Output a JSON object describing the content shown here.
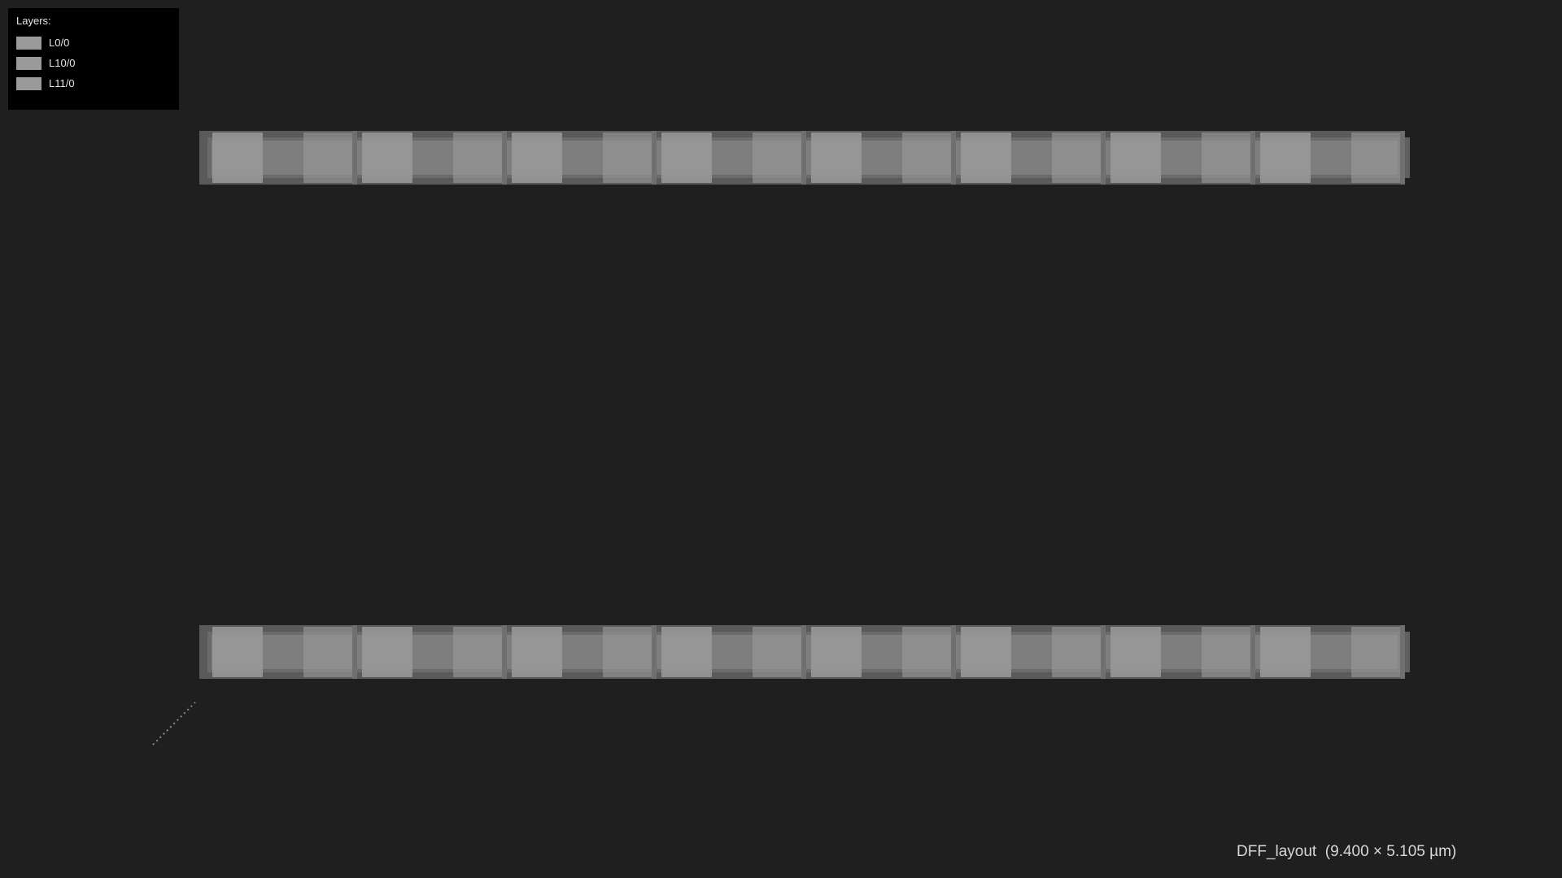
{
  "legend": {
    "title": "Layers:",
    "layers": [
      {
        "label": "L0/0",
        "color": "#9a9a9a"
      },
      {
        "label": "L10/0",
        "color": "#9a9a9a"
      },
      {
        "label": "L11/0",
        "color": "#9a9a9a"
      }
    ]
  },
  "canvas": {
    "background": "#1f1f1f",
    "rail_cells_per_row": 8,
    "rail_colors": {
      "outer": "#5a5a5a",
      "band": "#7e7e7e",
      "pad": "#9a9a9a",
      "edge": "#6f6f6f"
    }
  },
  "caption": {
    "name": "DFF_layout",
    "dimensions": "(9.400 × 5.105 µm)"
  }
}
